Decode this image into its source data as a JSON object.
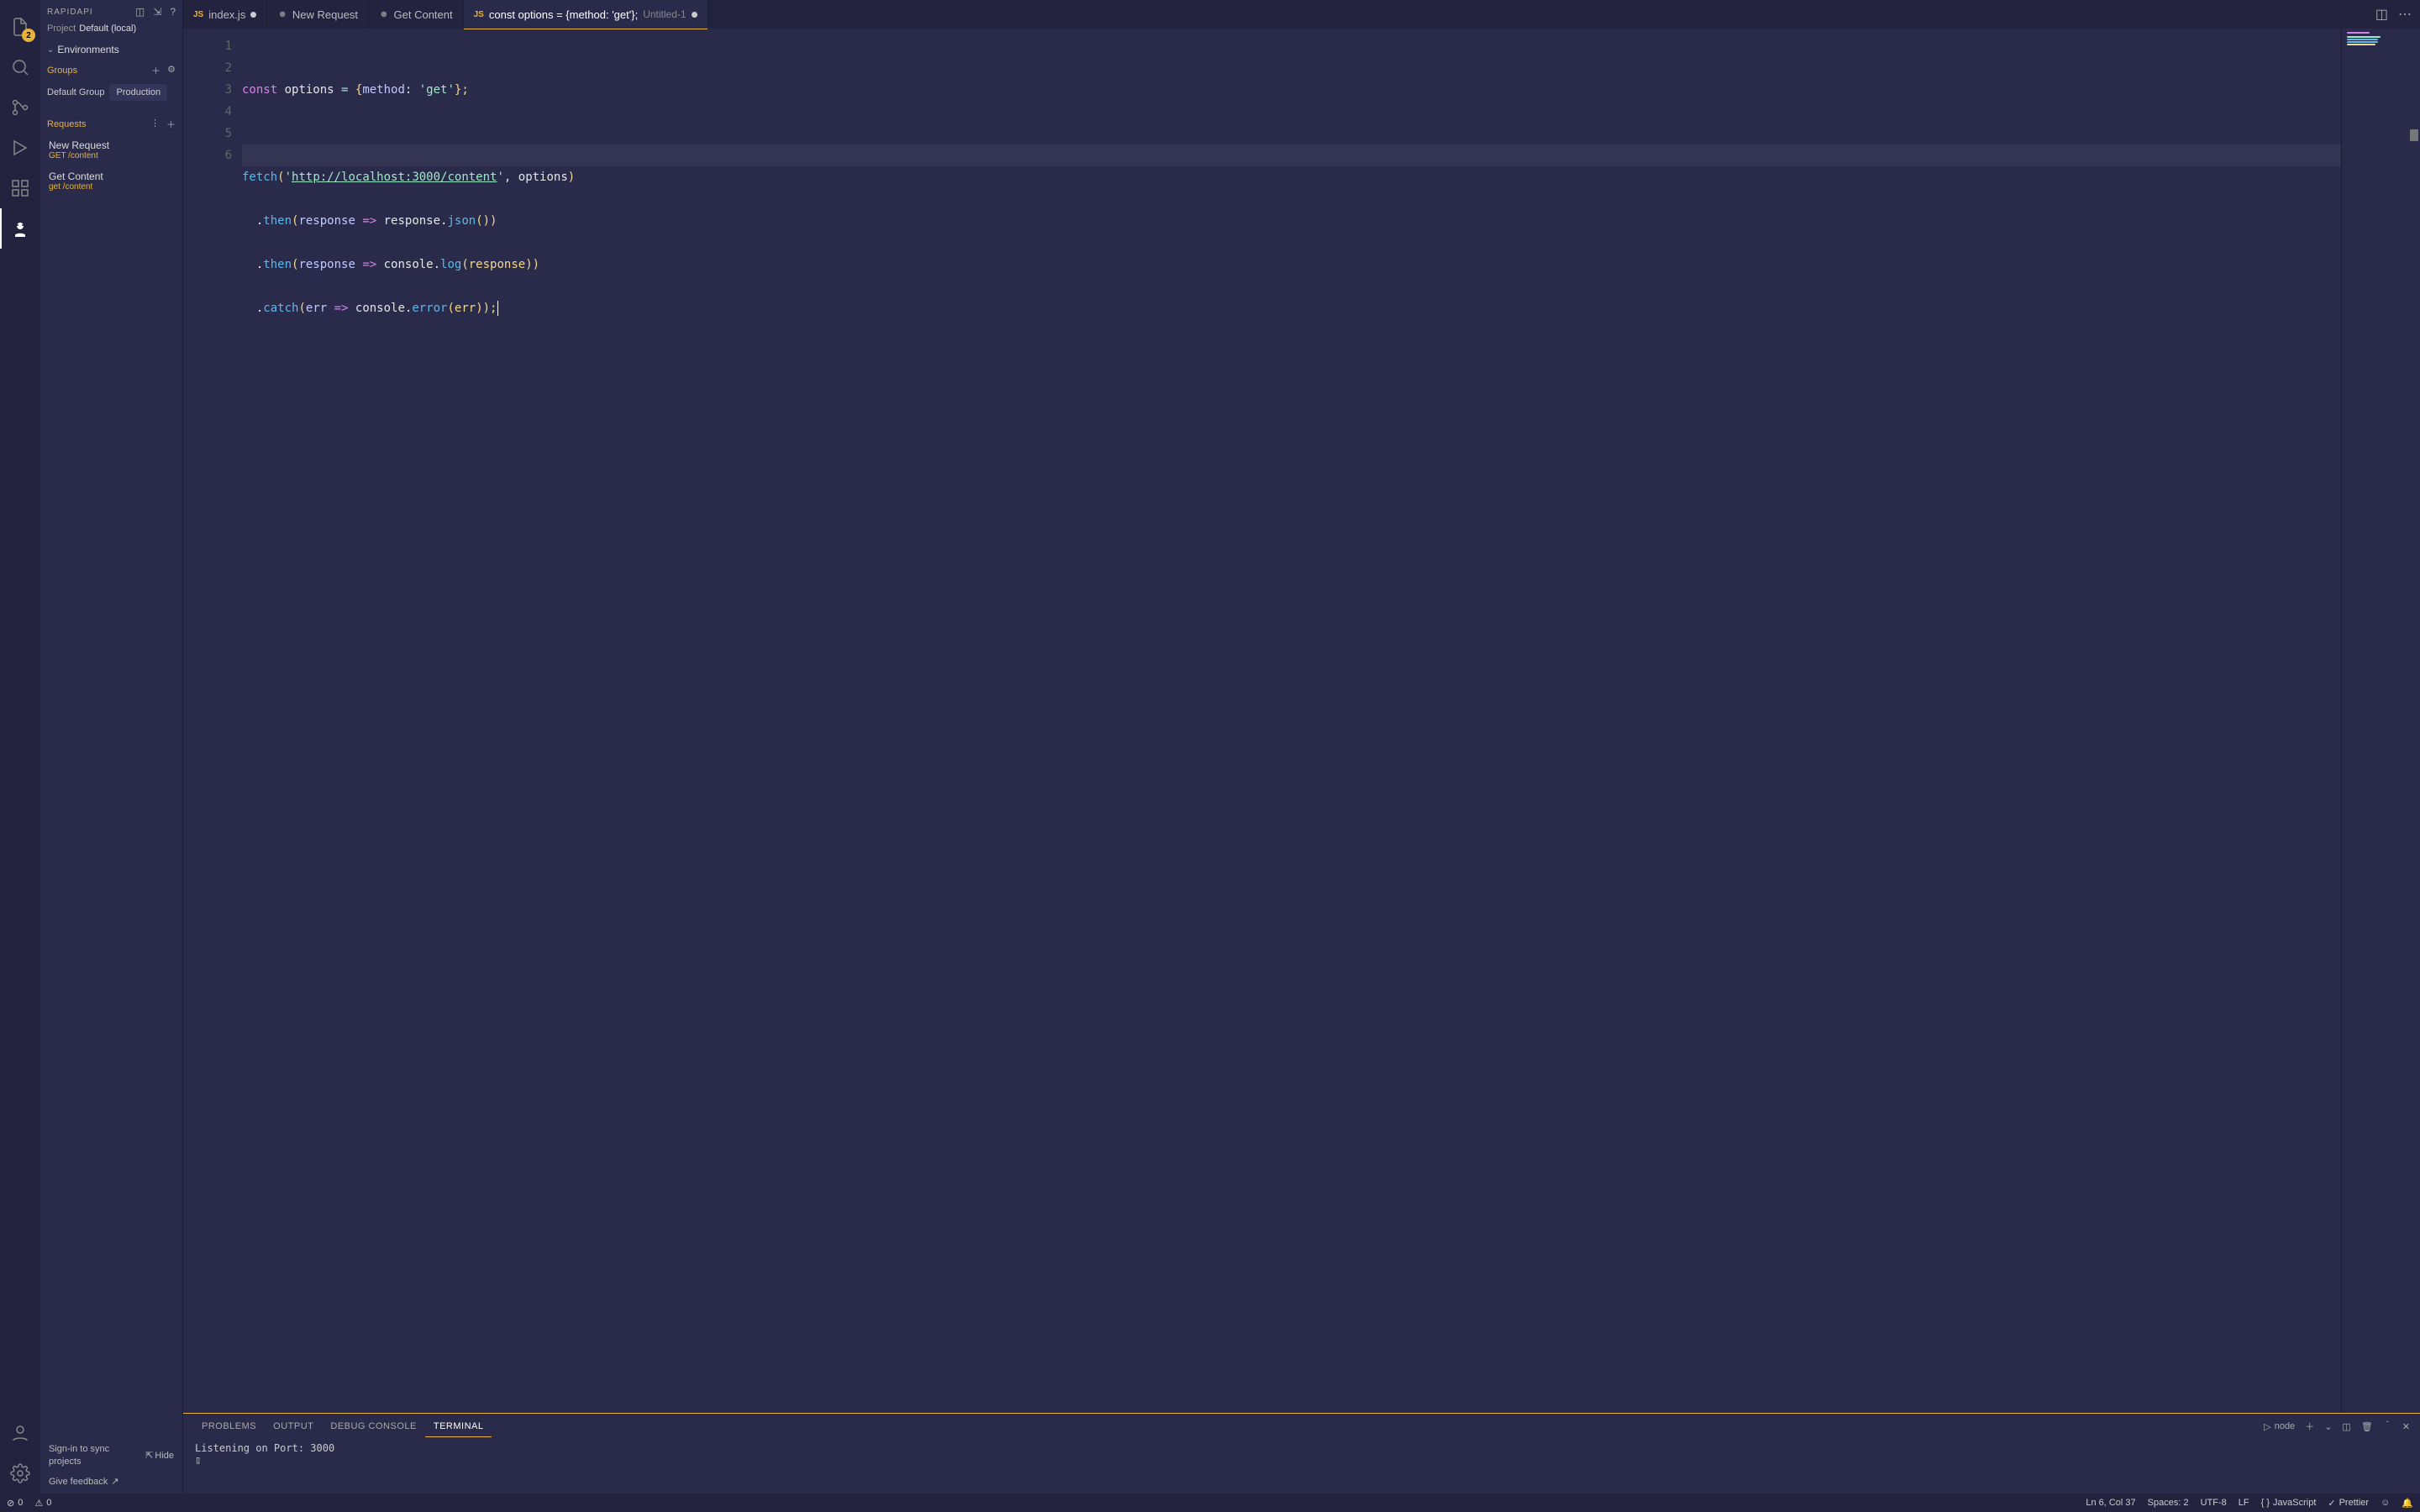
{
  "sidebar": {
    "title": "RAPIDAPI",
    "projectLabel": "Project",
    "projectValue": "Default (local)",
    "environmentsLabel": "Environments",
    "groupsLabel": "Groups",
    "group1": "Default Group",
    "group2": "Production",
    "requestsLabel": "Requests",
    "requests": [
      {
        "name": "New Request",
        "path": "GET /content"
      },
      {
        "name": "Get Content",
        "path": "get /content"
      }
    ],
    "syncText": "Sign-in to sync projects",
    "hideLabel": "Hide",
    "feedbackLabel": "Give feedback"
  },
  "activity": {
    "explorerBadge": "2"
  },
  "tabs": [
    {
      "icon": "js",
      "label": "index.js",
      "dirty": true,
      "active": false
    },
    {
      "icon": "octo",
      "label": "New Request",
      "dirty": false,
      "active": false
    },
    {
      "icon": "octo",
      "label": "Get Content",
      "dirty": false,
      "active": false
    },
    {
      "icon": "js",
      "label": "const options = {method: 'get'};",
      "small": "Untitled-1",
      "dirty": true,
      "active": true
    }
  ],
  "code": {
    "lines": [
      "1",
      "2",
      "3",
      "4",
      "5",
      "6"
    ],
    "l1": {
      "a": "const",
      "b": " options ",
      "c": "=",
      "d": " {",
      "e": "method",
      "f": ":",
      "g": " 'get'",
      "h": "};"
    },
    "l3": {
      "a": "fetch",
      "b": "(",
      "c": "'",
      "d": "http://localhost:3000/content",
      "e": "'",
      "f": ", options",
      "g": ")"
    },
    "l4": {
      "a": "  .",
      "b": "then",
      "c": "(",
      "d": "response ",
      "e": "=>",
      "f": " response.",
      "g": "json",
      "h": "())"
    },
    "l5": {
      "a": "  .",
      "b": "then",
      "c": "(",
      "d": "response ",
      "e": "=>",
      "f": " console.",
      "g": "log",
      "h": "(response",
      "i": "))"
    },
    "l6": {
      "a": "  .",
      "b": "catch",
      "c": "(",
      "d": "err ",
      "e": "=>",
      "f": " console.",
      "g": "error",
      "h": "(err",
      "i": "));"
    }
  },
  "panel": {
    "tabs": [
      "PROBLEMS",
      "OUTPUT",
      "DEBUG CONSOLE",
      "TERMINAL"
    ],
    "activeIndex": 3,
    "termShell": "node",
    "termOutput": "Listening on Port: 3000",
    "termPrompt": "▯"
  },
  "status": {
    "errors": "0",
    "warnings": "0",
    "cursor": "Ln 6, Col 37",
    "spaces": "Spaces: 2",
    "encoding": "UTF-8",
    "eol": "LF",
    "lang": "JavaScript",
    "prettier": "Prettier"
  }
}
